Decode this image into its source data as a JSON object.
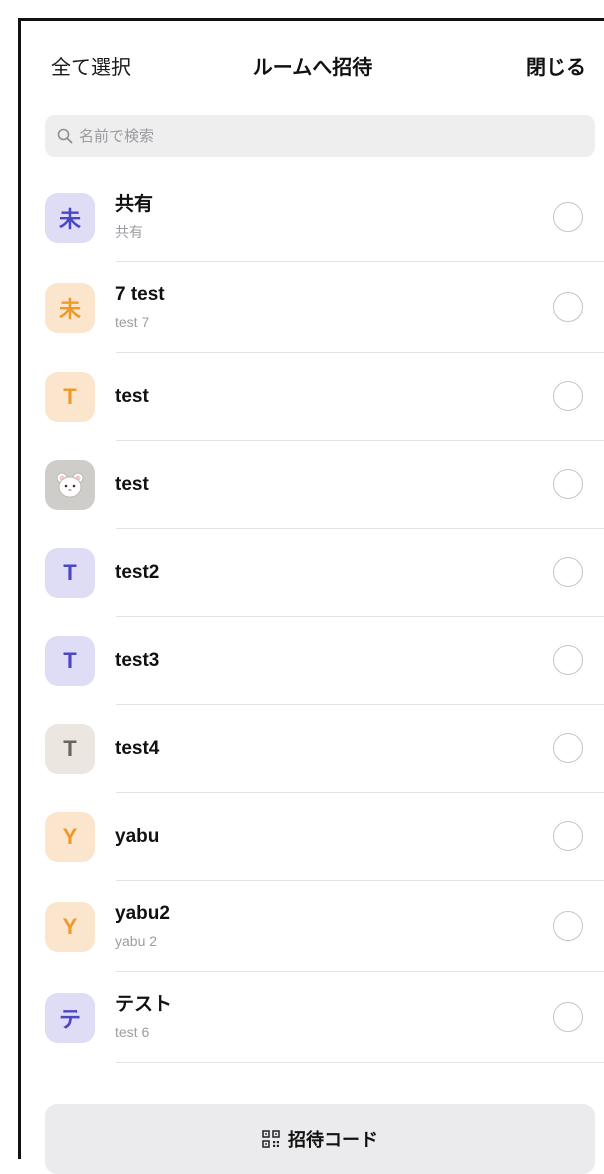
{
  "header": {
    "select_all": "全て選択",
    "title": "ルームへ招待",
    "close": "閉じる"
  },
  "search": {
    "placeholder": "名前で検索",
    "icon": "search-icon"
  },
  "rooms": [
    {
      "avatar": "未",
      "color": "purple",
      "name": "共有",
      "sub": "共有"
    },
    {
      "avatar": "未",
      "color": "orange",
      "name": "7 test",
      "sub": "test 7"
    },
    {
      "avatar": "T",
      "color": "orange",
      "name": "test",
      "sub": ""
    },
    {
      "avatar": "",
      "color": "gray",
      "icon": "hamster-icon",
      "name": "test",
      "sub": ""
    },
    {
      "avatar": "T",
      "color": "purple",
      "name": "test2",
      "sub": ""
    },
    {
      "avatar": "T",
      "color": "purple",
      "name": "test3",
      "sub": ""
    },
    {
      "avatar": "T",
      "color": "beige",
      "name": "test4",
      "sub": ""
    },
    {
      "avatar": "Y",
      "color": "orange",
      "name": "yabu",
      "sub": ""
    },
    {
      "avatar": "Y",
      "color": "orange",
      "name": "yabu2",
      "sub": "yabu 2"
    },
    {
      "avatar": "テ",
      "color": "purple",
      "name": "テスト",
      "sub": "test 6"
    }
  ],
  "footer": {
    "invite_code_label": "招待コード",
    "icon": "qr-code-icon"
  },
  "colors": {
    "purple_bg": "#dfdcf6",
    "purple_fg": "#4b46c6",
    "orange_bg": "#fbe6cd",
    "orange_fg": "#ee9a2b",
    "beige_bg": "#ebe6df",
    "beige_fg": "#6e6458"
  }
}
